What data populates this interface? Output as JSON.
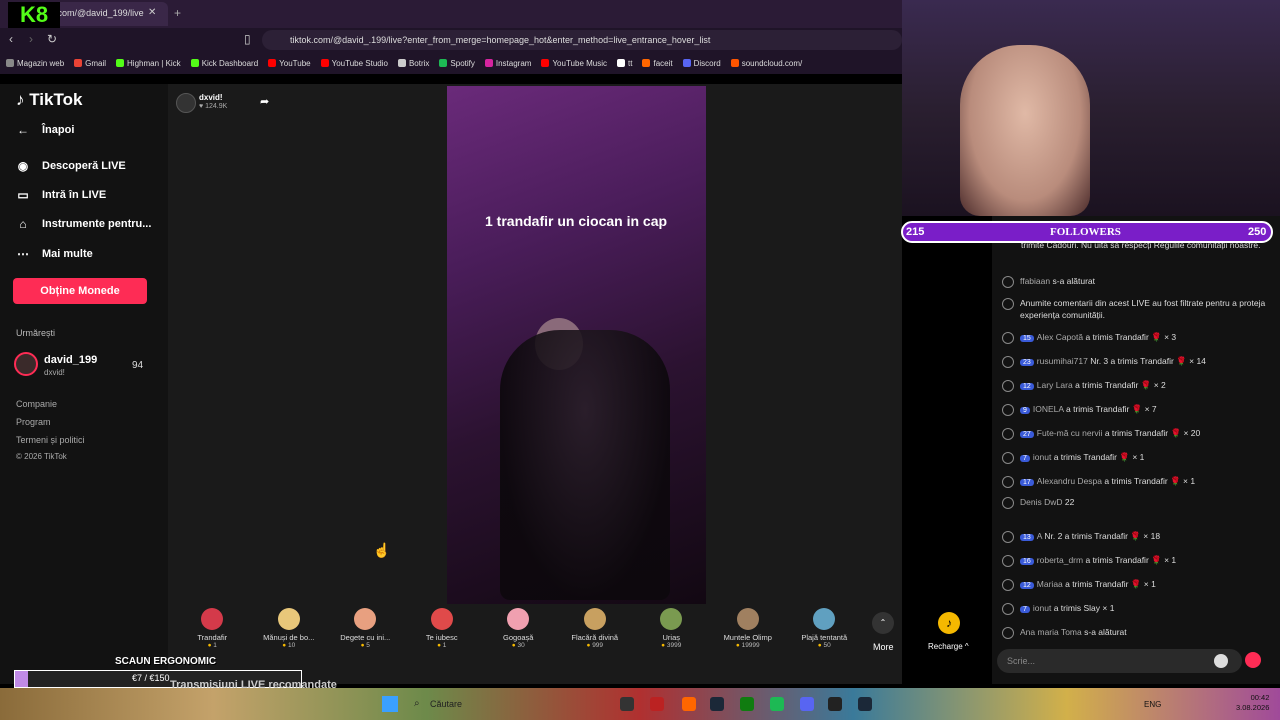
{
  "browser": {
    "tab_title": "tiktok.com/@david_199/live",
    "url": "tiktok.com/@david_.199/live?enter_from_merge=homepage_hot&enter_method=live_entrance_hover_list",
    "bookmarks": [
      "Magazin web",
      "Gmail",
      "Highman | Kick",
      "Kick Dashboard",
      "YouTube",
      "YouTube Studio",
      "Botrix",
      "Spotify",
      "Instagram",
      "YouTube Music",
      "tt",
      "faceit",
      "Discord",
      "soundcloud.com/"
    ]
  },
  "sidebar": {
    "logo": "TikTok",
    "back": "Înapoi",
    "items": [
      "Descoperă LIVE",
      "Intră în LIVE",
      "Instrumente pentru...",
      "Mai multe"
    ],
    "coins_button": "Obține Monede",
    "following_header": "Urmărești",
    "following": {
      "name": "david_199",
      "sub": "dxvid!",
      "count": "94"
    },
    "footer": [
      "Companie",
      "Program",
      "Termeni și politici",
      "© 2026 TikTok"
    ]
  },
  "stream": {
    "host_name": "dxvid!",
    "likes": "124.9K",
    "overlay_text": "1 trandafir un ciocan in cap"
  },
  "gifts": [
    {
      "name": "Trandafir",
      "price": "1"
    },
    {
      "name": "Mănuși de bo...",
      "price": "10"
    },
    {
      "name": "Degete cu ini...",
      "price": "5"
    },
    {
      "name": "Te iubesc",
      "price": "1"
    },
    {
      "name": "Gogoașă",
      "price": "30"
    },
    {
      "name": "Flacără divină",
      "price": "999"
    },
    {
      "name": "Uriaș",
      "price": "3999"
    },
    {
      "name": "Muntele Olimp",
      "price": "19999"
    },
    {
      "name": "Plajă tentantă",
      "price": "50"
    }
  ],
  "gift_colors": [
    "#d43a4a",
    "#e8c77a",
    "#e8a080",
    "#e04a4a",
    "#f0a0b0",
    "#c8a060",
    "#7a9a50",
    "#a08060",
    "#60a0c0"
  ],
  "more_label": "More",
  "recharge_label": "Recharge ^",
  "chat": {
    "top_text": "trimite Cadouri. Nu uita să respecți Regulile comunității noastre.",
    "messages": [
      {
        "level": "",
        "user": "ffabiaan",
        "text": "s-a alăturat"
      },
      {
        "level": "",
        "user": "",
        "text": "Anumite comentarii din acest LIVE au fost filtrate pentru a proteja experiența comunității."
      },
      {
        "level": "15",
        "user": "Alex Capotă",
        "text": "a trimis Trandafir 🌹 × 3"
      },
      {
        "level": "23",
        "user": "rusumihai717",
        "text": "Nr. 3 a trimis Trandafir 🌹 × 14"
      },
      {
        "level": "12",
        "user": "Lary Lara",
        "text": "a trimis Trandafir 🌹 × 2"
      },
      {
        "level": "9",
        "user": "IONELA",
        "text": "a trimis Trandafir 🌹 × 7"
      },
      {
        "level": "27",
        "user": "Fute-mă cu nervii",
        "text": "a trimis Trandafir 🌹 × 20"
      },
      {
        "level": "7",
        "user": "ionut",
        "text": "a trimis Trandafir 🌹 × 1"
      },
      {
        "level": "17",
        "user": "Alexandru Despa",
        "text": "a trimis Trandafir 🌹 × 1"
      },
      {
        "level": "",
        "user": "Denis DwD",
        "text": "22"
      },
      {
        "level": "13",
        "user": "A",
        "text": "Nr. 2 a trimis Trandafir 🌹 × 18"
      },
      {
        "level": "16",
        "user": "roberta_drm",
        "text": "a trimis Trandafir 🌹 × 1"
      },
      {
        "level": "12",
        "user": "Mariaa",
        "text": "a trimis Trandafir 🌹 × 1"
      },
      {
        "level": "7",
        "user": "ionut",
        "text": "a trimis Slay × 1"
      },
      {
        "level": "",
        "user": "Ana maria Toma",
        "text": "s-a alăturat"
      }
    ],
    "input_placeholder": "Scrie..."
  },
  "followers_bar": {
    "left": "215",
    "title": "FOLLOWERS",
    "right": "250"
  },
  "overlay": {
    "goal_title": "SCAUN ERGONOMIC",
    "goal_amount": "€7 / €150",
    "goal_progress": 0.047,
    "recommended": "Transmisiuni LIVE recomandate"
  },
  "taskbar": {
    "search": "Căutare",
    "lang": "ENG",
    "time": "00:42",
    "date": "3.08.2026"
  }
}
